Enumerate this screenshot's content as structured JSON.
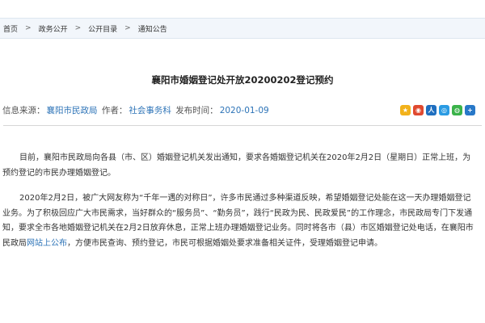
{
  "breadcrumb": {
    "items": [
      "首页",
      "政务公开",
      "公开目录",
      "通知公告"
    ],
    "separator": ">"
  },
  "article": {
    "title": "襄阳市婚姻登记处开放20200202登记预约",
    "meta": {
      "source_label": "信息来源：",
      "source_value": "襄阳市民政局",
      "author_label": "作者：",
      "author_value": "社会事务科",
      "date_label": "发布时间：",
      "date_value": "2020-01-09"
    },
    "paragraphs": [
      "目前，襄阳市民政局向各县（市、区）婚姻登记机关发出通知，要求各婚姻登记机关在2020年2月2日（星期日）正常上班，为预约登记的市民办理婚姻登记。",
      "2020年2月2日，被广大网友称为“千年一遇的对称日”，许多市民通过多种渠道反映，希望婚姻登记处能在这一天办理婚姻登记业务。为了积极回应广大市民需求，当好群众的“服务员”、“勤务员”，践行“民政为民、民政爱民”的工作理念，市民政局专门下发通知，要求全市各地婚姻登记机关在2月2日放弃休息，正常上班办理婚姻登记业务。同时将各市（县）市区婚姻登记处电话，在襄阳市民政局",
      "网站上公布",
      "，方便市民查询、预约登记，市民可根据婚姻处要求准备相关证件，受理婚姻登记申请。"
    ]
  },
  "share": {
    "icons": [
      {
        "name": "qzone-icon",
        "glyph": "★",
        "color": "#f2b21b"
      },
      {
        "name": "weibo-icon",
        "glyph": "◉",
        "color": "#e0492f"
      },
      {
        "name": "renren-icon",
        "glyph": "人",
        "color": "#1f6fc0"
      },
      {
        "name": "tencent-weibo-icon",
        "glyph": "◎",
        "color": "#2a9be3"
      },
      {
        "name": "wechat-icon",
        "glyph": "◍",
        "color": "#3bb34a"
      },
      {
        "name": "more-icon",
        "glyph": "+",
        "color": "#2878c8"
      }
    ]
  }
}
